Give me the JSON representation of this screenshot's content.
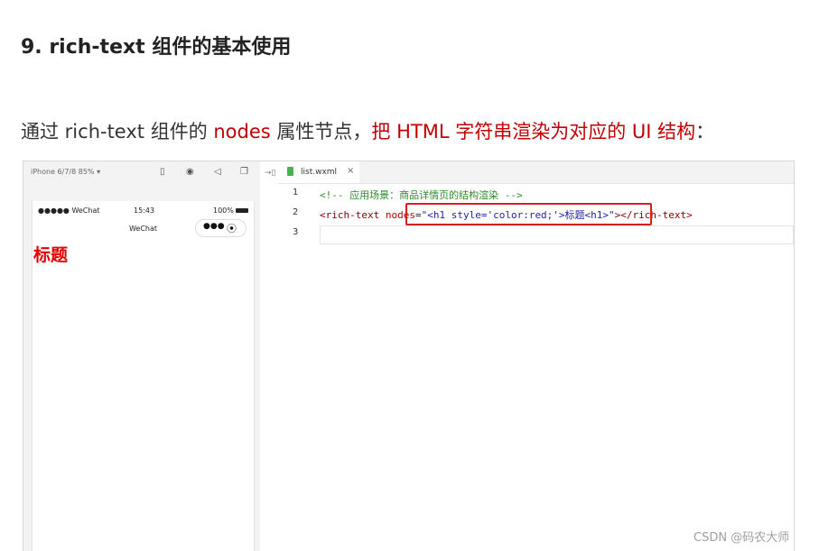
{
  "heading": "9. rich-text 组件的基本使用",
  "paragraph": {
    "part1": "通过 rich-text 组件的 ",
    "part2": "nodes",
    "part3": " 属性节点，",
    "part4": "把 HTML 字符串渲染为对应的 UI 结构",
    "part5": "："
  },
  "simulator": {
    "device": "iPhone 6/7/8 85% ▾",
    "carrier": "●●●●● WeChat",
    "time": "15:43",
    "battery": "100%",
    "nav_title": "WeChat",
    "capsule_dots": "●●●",
    "capsule_target": "⦿",
    "rendered_heading": "标题"
  },
  "editor": {
    "tab_label": "list.wxml",
    "tab_close": "×",
    "lines": [
      {
        "num": "1",
        "comment": "<!-- 应用场景：商品详情页的结构渲染 -->"
      },
      {
        "num": "2",
        "tag_open": "<rich-text ",
        "attr": "nodes",
        "eq": "=",
        "value": "\"<h1 style='color:red;'>标题<h1>\"",
        "tag_close": "></rich-text>"
      },
      {
        "num": "3"
      }
    ]
  },
  "watermark": "CSDN @码农大师"
}
